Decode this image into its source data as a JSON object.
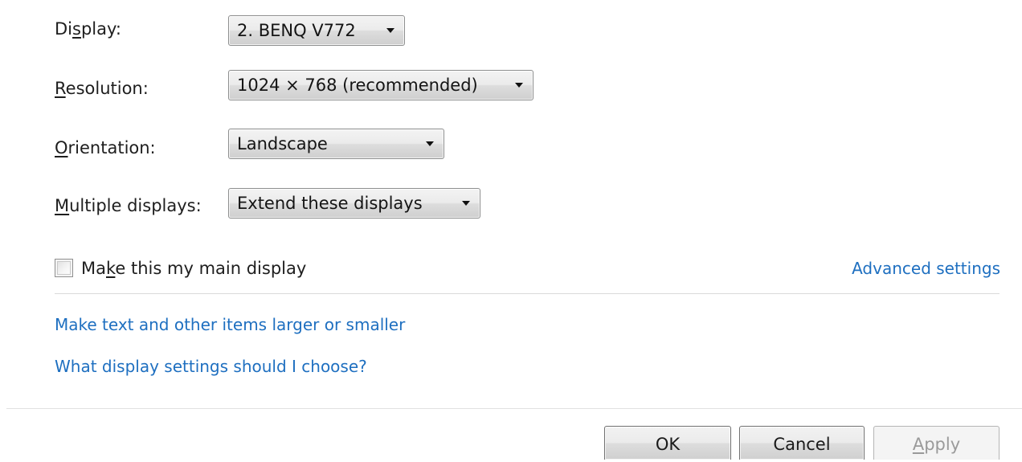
{
  "settings": {
    "display": {
      "label_pre": "Di",
      "label_mn": "s",
      "label_post": "play:",
      "value": "2. BENQ V772"
    },
    "resolution": {
      "label_pre": "",
      "label_mn": "R",
      "label_post": "esolution:",
      "value": "1024 × 768 (recommended)"
    },
    "orientation": {
      "label_pre": "",
      "label_mn": "O",
      "label_post": "rientation:",
      "value": "Landscape"
    },
    "multiple_displays": {
      "label_pre": "",
      "label_mn": "M",
      "label_post": "ultiple displays:",
      "value": "Extend these displays"
    }
  },
  "main_display": {
    "label_pre": "Ma",
    "label_mn": "k",
    "label_post": "e this my main display",
    "checked": false
  },
  "links": {
    "advanced": "Advanced settings",
    "text_size": "Make text and other items larger or smaller",
    "help": "What display settings should I choose?"
  },
  "buttons": {
    "ok": "OK",
    "cancel": "Cancel",
    "apply_mn": "A",
    "apply_rest": "pply"
  }
}
